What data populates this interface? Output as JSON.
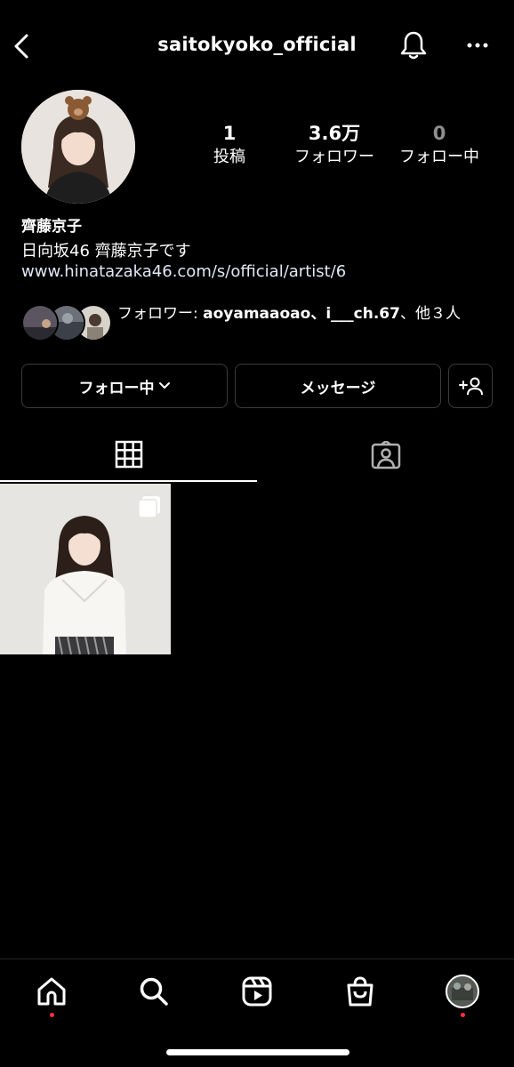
{
  "header": {
    "username": "saitokyoko_official",
    "back_icon": "chevron-left-icon",
    "bell_icon": "bell-icon",
    "more_icon": "more-horizontal-icon"
  },
  "profile": {
    "stats": [
      {
        "value": "1",
        "label": "投稿"
      },
      {
        "value": "3.6万",
        "label": "フォロワー"
      },
      {
        "value": "0",
        "label": "フォロー中"
      }
    ],
    "display_name": "齊藤京子",
    "bio": "日向坂46 齊藤京子です",
    "link": "www.hinatazaka46.com/s/official/artist/6",
    "followed_by": {
      "prefix": "フォロワー: ",
      "names": "aoyamaaoao、i___ch.67",
      "suffix": "、他３人"
    }
  },
  "actions": {
    "following_label": "フォロー中",
    "message_label": "メッセージ",
    "add_user_icon": "add-user-icon"
  },
  "tabs": [
    {
      "icon": "grid-icon",
      "selected": true
    },
    {
      "icon": "tagged-icon",
      "selected": false
    }
  ],
  "bottom_nav": [
    {
      "icon": "home-icon",
      "notification": true
    },
    {
      "icon": "search-icon",
      "notification": false
    },
    {
      "icon": "reels-icon",
      "notification": false
    },
    {
      "icon": "shop-icon",
      "notification": false
    },
    {
      "icon": "profile-avatar",
      "notification": true
    }
  ],
  "colors": {
    "background": "#000000",
    "text": "#ffffff",
    "muted": "#8e8e8e",
    "border": "#3a3a3a",
    "notification_dot": "#ff3040"
  }
}
